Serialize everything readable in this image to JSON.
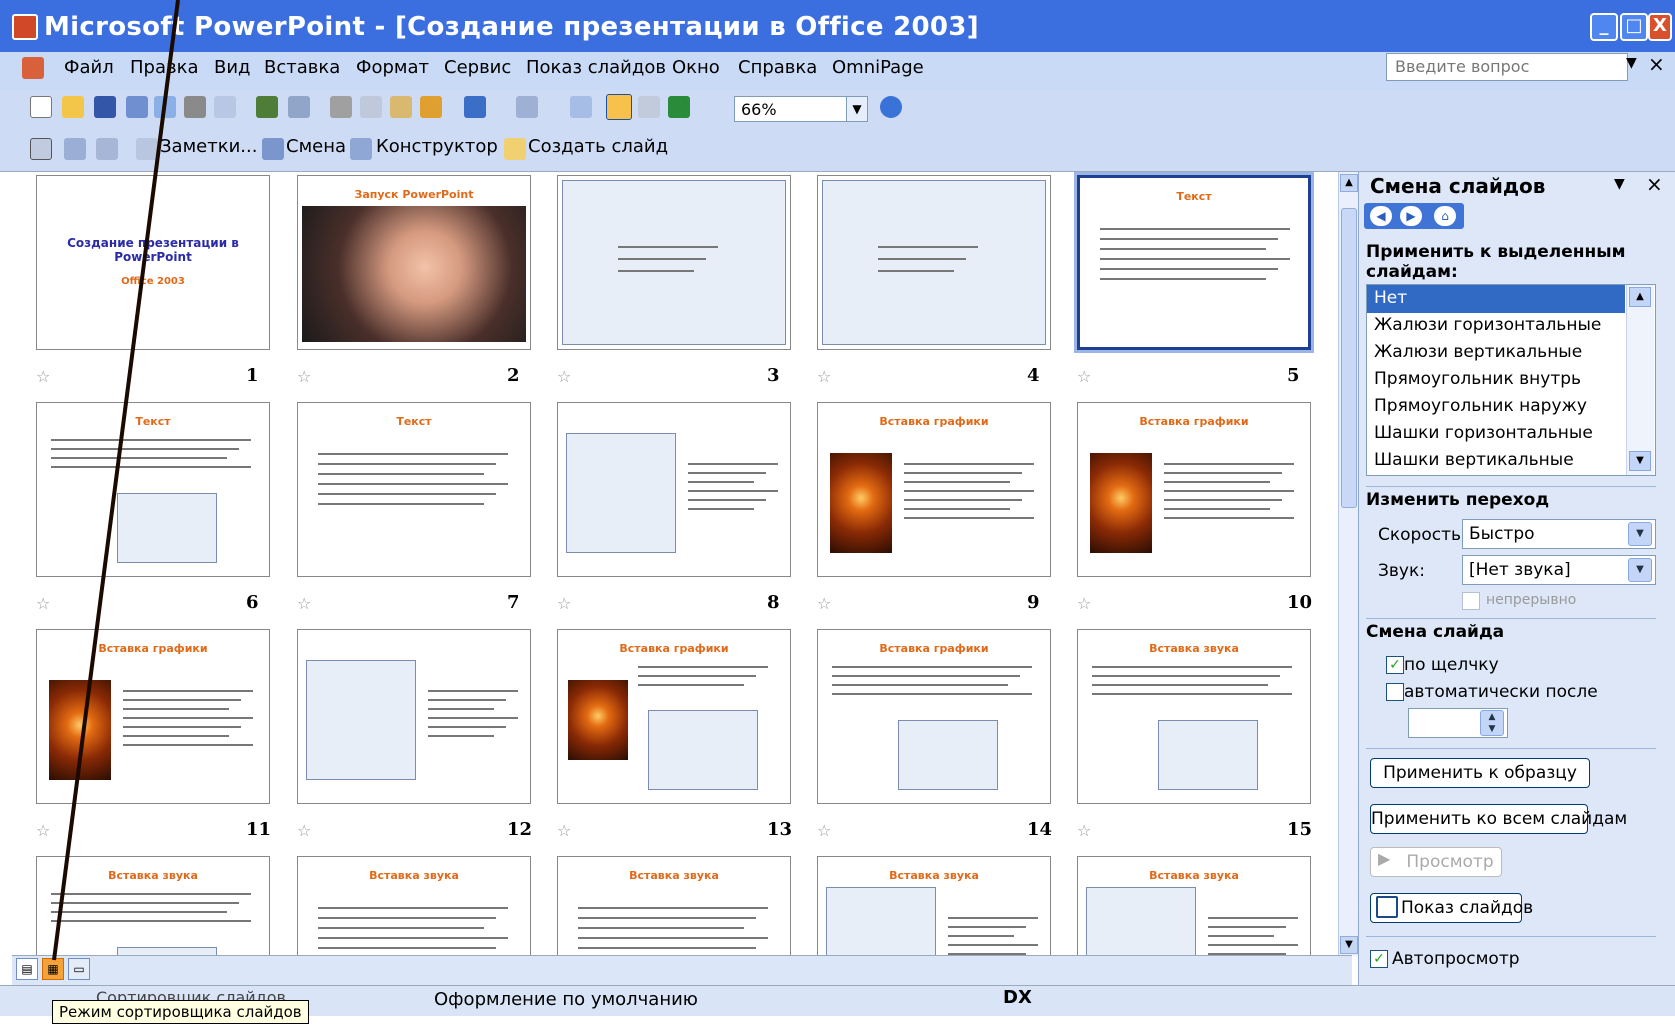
{
  "window": {
    "title": "Microsoft PowerPoint - [Создание презентации в Office 2003]",
    "min_symbol": "_",
    "max_symbol": "□",
    "close_symbol": "X"
  },
  "menu": {
    "items": [
      "Файл",
      "Правка",
      "Вид",
      "Вставка",
      "Формат",
      "Сервис",
      "Показ слайдов",
      "Окно",
      "Справка",
      "OmniPage"
    ],
    "help_placeholder": "Введите вопрос",
    "close_symbol": "×"
  },
  "toolbar": {
    "zoom": "66%",
    "notes_label": "Заметки...",
    "transition_label": "Смена",
    "design_label": "Конструктор",
    "new_slide_label": "Создать слайд"
  },
  "slides": [
    {
      "num": "1",
      "title": "Создание презентации в PowerPoint",
      "subtitle": "Office 2003"
    },
    {
      "num": "2",
      "title": "Запуск PowerPoint"
    },
    {
      "num": "3"
    },
    {
      "num": "4"
    },
    {
      "num": "5",
      "title": "Текст"
    },
    {
      "num": "6",
      "title": "Текст"
    },
    {
      "num": "7",
      "title": "Текст"
    },
    {
      "num": "8"
    },
    {
      "num": "9",
      "title": "Вставка графики"
    },
    {
      "num": "10",
      "title": "Вставка графики"
    },
    {
      "num": "11",
      "title": "Вставка графики"
    },
    {
      "num": "12"
    },
    {
      "num": "13",
      "title": "Вставка графики"
    },
    {
      "num": "14",
      "title": "Вставка графики"
    },
    {
      "num": "15",
      "title": "Вставка звука"
    },
    {
      "num": "",
      "title": "Вставка звука"
    },
    {
      "num": "",
      "title": "Вставка звука"
    },
    {
      "num": "",
      "title": "Вставка звука"
    },
    {
      "num": "",
      "title": "Вставка звука"
    },
    {
      "num": "",
      "title": "Вставка звука"
    }
  ],
  "taskpane": {
    "title": "Смена слайдов",
    "apply_heading": "Применить к выделенным слайдам:",
    "transitions": [
      "Нет",
      "Жалюзи горизонтальные",
      "Жалюзи вертикальные",
      "Прямоугольник внутрь",
      "Прямоугольник наружу",
      "Шашки горизонтальные",
      "Шашки вертикальные"
    ],
    "modify_heading": "Изменить переход",
    "speed_label": "Скорость:",
    "speed_value": "Быстро",
    "sound_label": "Звук:",
    "sound_value": "[Нет звука]",
    "loop_label": "непрерывно",
    "advance_heading": "Смена слайда",
    "on_click_label": "по щелчку",
    "auto_label": "автоматически после",
    "apply_master_btn": "Применить к образцу",
    "apply_all_btn": "Применить ко всем слайдам",
    "preview_btn": "Просмотр",
    "slideshow_btn": "Показ слайдов",
    "autopreview_label": "Автопросмотр"
  },
  "statusbar": {
    "view_name": "Сортировщик слайдов",
    "design": "Оформление по умолчанию",
    "lang_icon": "DX"
  },
  "tooltip": "Режим сортировщика слайдов"
}
